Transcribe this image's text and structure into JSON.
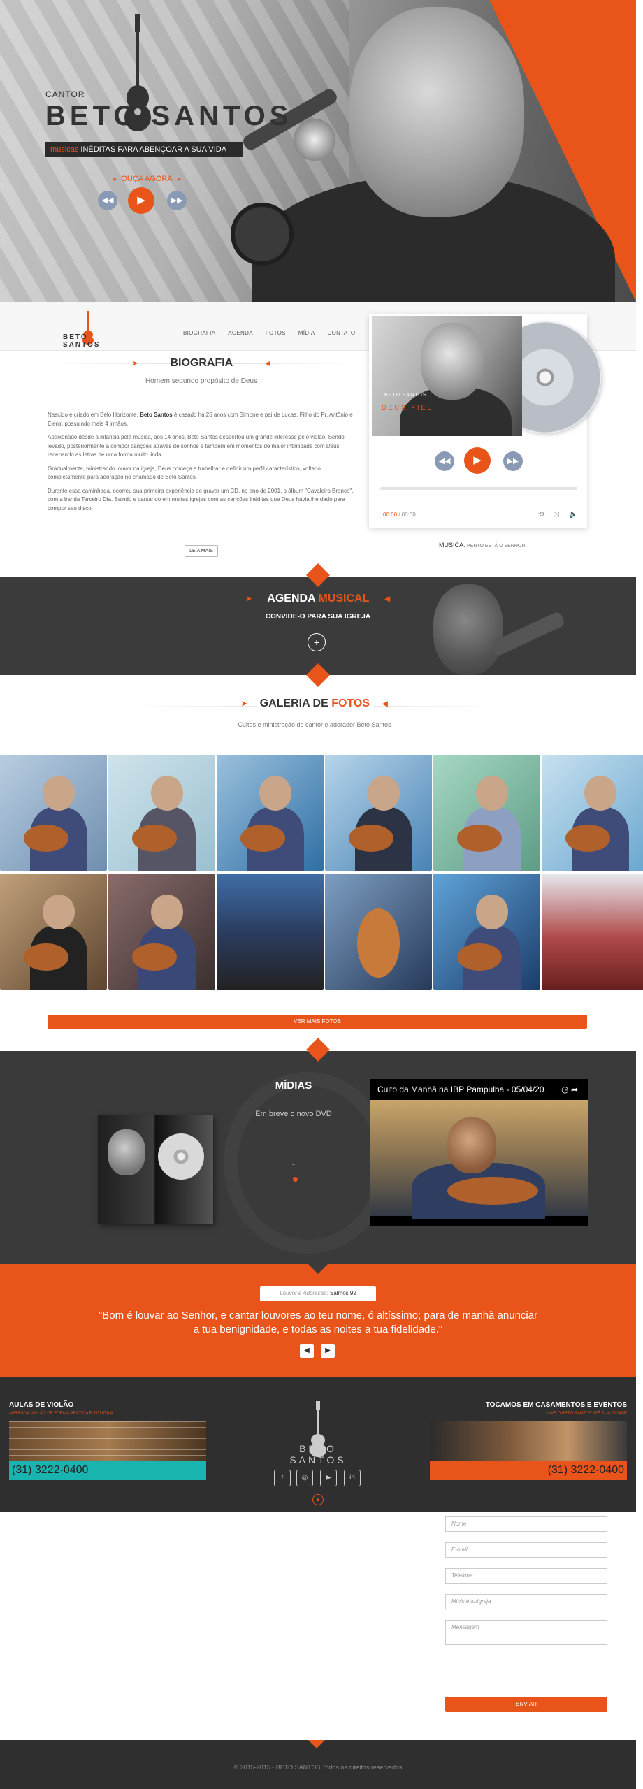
{
  "hero": {
    "cantor": "CANTOR",
    "name": "BETO SANTOS",
    "tagline_accent": "músicas",
    "tagline": "INÉDITAS PARA ABENÇOAR A SUA VIDA",
    "listen_label": "OUÇA AGORA",
    "prev_icon": "rewind-icon",
    "play_icon": "play-icon",
    "next_icon": "fast-forward-icon"
  },
  "nav": {
    "logo": "BETO SANTOS",
    "items": [
      "BIOGRAFIA",
      "AGENDA",
      "FOTOS",
      "MÍDIA",
      "CONTATO"
    ]
  },
  "bio": {
    "title": "BIOGRAFIA",
    "subtitle": "Homem segundo propósito de Deus",
    "p1_a": "Nascido e criado em Belo Horizonte, ",
    "p1_b": "Beto Santos",
    "p1_c": " é casado há 26 anos com Simone e pai de Lucas. Filho do Pr. Antônio e Elenir, possuindo mais 4 irmãos.",
    "p2": "Apaixonado desde a infância pela música, aos 14 anos, Beto Santos despertou um grande interesse pelo violão. Sendo levado, posteriormente a compor canções através de sonhos e também em momentos de maior intimidade com Deus, recebendo as letras de uma forma muito linda.",
    "p3": "Gradualmente, ministrando louvor na igreja, Deus começa a trabalhar e definir um perfil característico, voltado completamente para adoração no chamado de Beto Santos.",
    "p4": "Durante essa caminhada, ocorreu sua primeira experiência de gravar um CD, no ano de 2001, o álbum \"Cavaleiro Branco\", com a banda Terceiro Dia. Saindo e cantando em muitas igrejas com as canções inéditas que Deus havia lhe dado para compor seu disco.",
    "read_more": "LEIA MAIS"
  },
  "player": {
    "album_logo": "BETO SANTOS",
    "album_title": "DEUS FIEL",
    "time_current": "00:00",
    "time_total": "/ 00:00",
    "progress": 0,
    "now_label": "MÚSICA:",
    "now_song": "PERTO ESTÁ O SENHOR"
  },
  "agenda": {
    "title_a": "AGENDA",
    "title_b": "MUSICAL",
    "subtitle": "CONVIDE-O PARA SUA IGREJA",
    "plus": "+"
  },
  "gallery": {
    "title_a": "GALERIA DE",
    "title_b": "FOTOS",
    "subtitle": "Cultos e ministração do cantor e adorador Beto Santos",
    "see_more": "VER MAIS FOTOS"
  },
  "midias": {
    "title": "MÍDIAS",
    "subtitle": "Em breve o novo DVD",
    "dash": "-",
    "video_title": "Culto da Manhã na IBP Pampulha - 05/04/20..."
  },
  "quote": {
    "ref_label": "Louvor e Adoração:",
    "ref": "Salmos 92",
    "line1": "\"Bom é louvar ao Senhor, e cantar louvores ao teu nome, ó altíssimo; para de manhã anunciar",
    "line2": "a tua benignidade, e todas as noites a tua fidelidade.\""
  },
  "footer": {
    "aulas_title": "AULAS DE VIOLÃO",
    "aulas_sub": "APRENDA VIOLÃO DE FORMA PRÁTICA E INTUITIVA",
    "aulas_phone": "(31) 3222-0400",
    "logo": "BETO SANTOS",
    "toc_title": "TOCAMOS EM CASAMENTOS E EVENTOS",
    "toc_sub": "LIVE O BETO SANTOS ATÉ SUA CIDADE",
    "toc_phone": "(31) 3222-0400"
  },
  "form": {
    "name": "Nome",
    "email": "E-mail",
    "phone": "Telefone",
    "ministry": "Ministério/Igreja",
    "message": "Mensagem",
    "submit": "ENVIAR"
  },
  "copyright": "© 2015-2015 - BETO SANTOS Todos os direitos reservados"
}
